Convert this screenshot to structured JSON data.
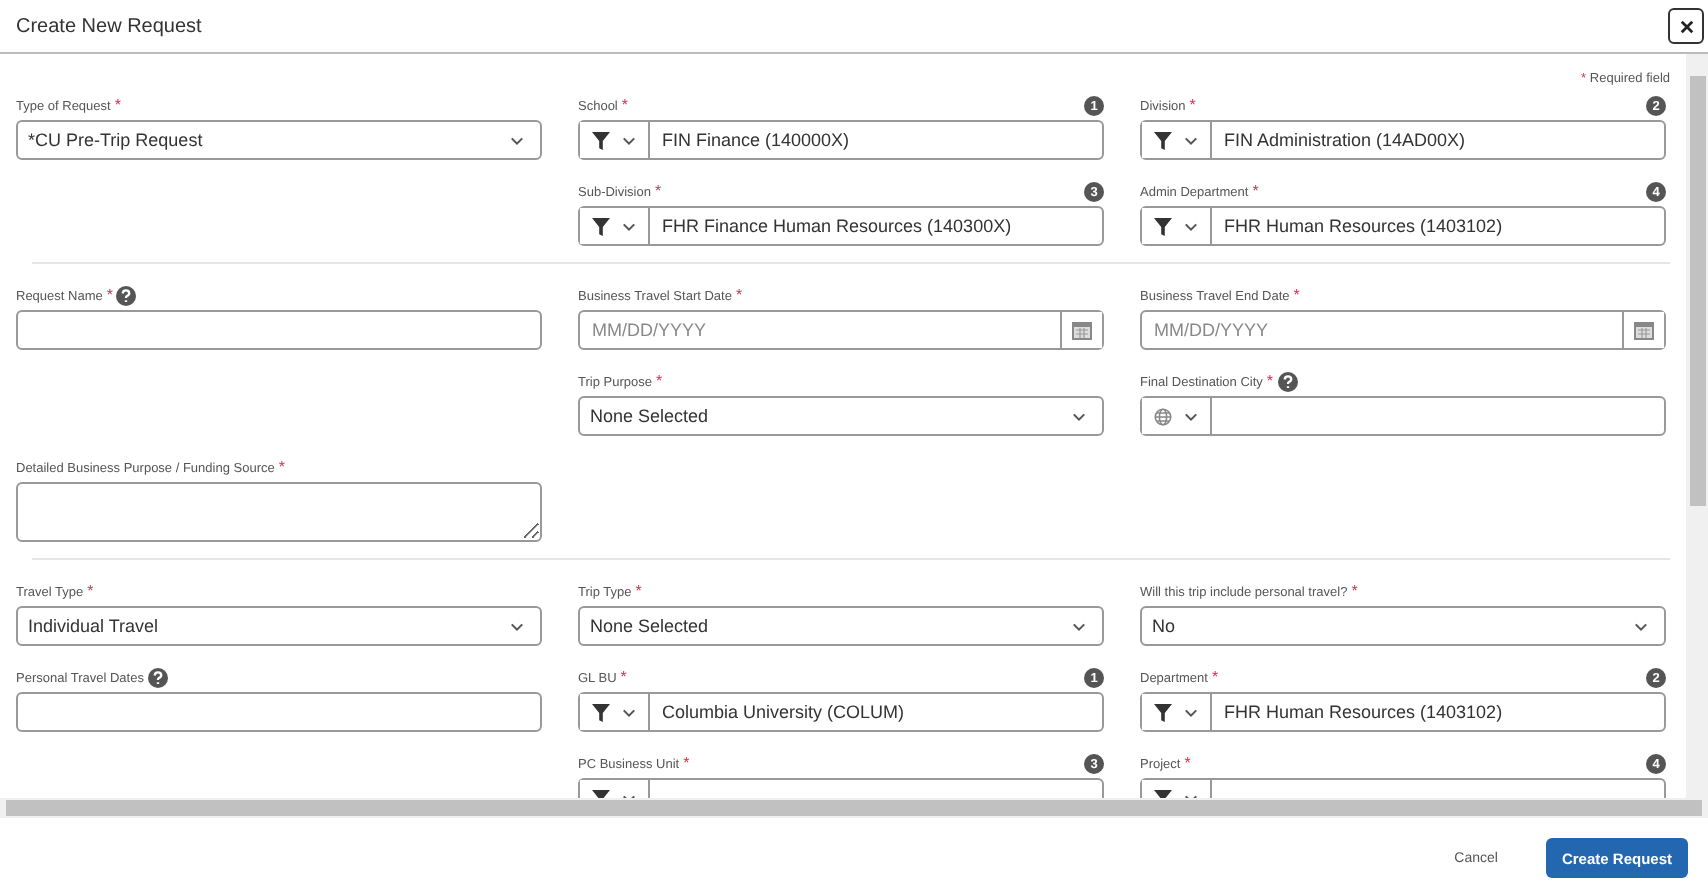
{
  "window": {
    "title": "Create New Request"
  },
  "required_note": {
    "mark": "*",
    "text": "Required field"
  },
  "sections": [
    {
      "rows": [
        [
          {
            "kind": "select",
            "label": "Type of Request",
            "mark": "*",
            "value": "*CU Pre-Trip Request"
          },
          {
            "kind": "filter",
            "label": "School",
            "mark": "*",
            "badge": "1",
            "value": "FIN Finance (140000X)"
          },
          {
            "kind": "filter",
            "label": "Division",
            "mark": "*",
            "badge": "2",
            "value": "FIN Administration (14AD00X)"
          }
        ],
        [
          null,
          {
            "kind": "filter",
            "label": "Sub-Division",
            "mark": "*",
            "badge": "3",
            "value": "FHR Finance Human Resources (140300X)"
          },
          {
            "kind": "filter",
            "label": "Admin Department",
            "mark": "*",
            "badge": "4",
            "value": "FHR Human Resources (1403102)"
          }
        ]
      ]
    },
    {
      "rows": [
        [
          {
            "kind": "text",
            "label": "Request Name",
            "mark": "*",
            "help": true
          },
          {
            "kind": "date",
            "label": "Business Travel Start Date",
            "mark": "*",
            "placeholder": "MM/DD/YYYY"
          },
          {
            "kind": "date",
            "label": "Business Travel End Date",
            "mark": "*",
            "placeholder": "MM/DD/YYYY"
          }
        ],
        [
          null,
          {
            "kind": "select",
            "label": "Trip Purpose",
            "mark": "*",
            "value": "None Selected"
          },
          {
            "kind": "location",
            "label": "Final Destination City",
            "mark": "*",
            "help": true
          }
        ],
        [
          {
            "kind": "textarea",
            "label": "Detailed Business Purpose / Funding Source",
            "mark": "*"
          },
          null,
          null
        ]
      ]
    },
    {
      "rows": [
        [
          {
            "kind": "select",
            "label": "Travel Type",
            "mark": "*",
            "value": "Individual Travel"
          },
          {
            "kind": "select",
            "label": "Trip Type",
            "mark": "*",
            "value": "None Selected"
          },
          {
            "kind": "select",
            "label": "Will this trip include personal travel?",
            "mark": "*",
            "value": "No"
          }
        ],
        [
          {
            "kind": "text",
            "label": "Personal Travel Dates",
            "help": true
          },
          {
            "kind": "filter",
            "label": "GL BU",
            "mark": "*",
            "badge": "1",
            "value": "Columbia University (COLUM)"
          },
          {
            "kind": "filter",
            "label": "Department",
            "mark": "*",
            "badge": "2",
            "value": "FHR Human Resources (1403102)"
          }
        ],
        [
          null,
          {
            "kind": "filter",
            "label": "PC Business Unit",
            "mark": "*",
            "badge": "3"
          },
          {
            "kind": "filter",
            "label": "Project",
            "mark": "*",
            "badge": "4"
          }
        ]
      ]
    }
  ],
  "footer": {
    "cancel": "Cancel",
    "submit": "Create Request"
  }
}
